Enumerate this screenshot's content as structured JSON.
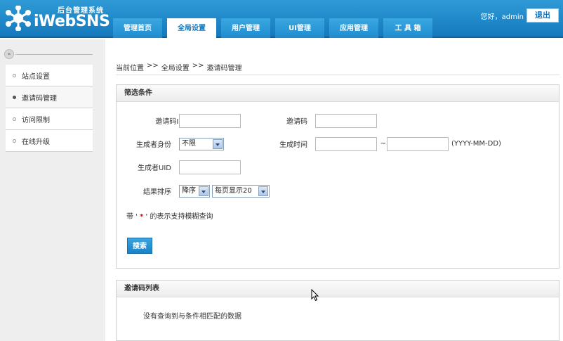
{
  "header": {
    "logo_small": "后台管理系统",
    "logo_big": "iWebSNS",
    "greeting": "您好，admin",
    "logout_label": "退出"
  },
  "nav": {
    "tabs": [
      {
        "label": "管理首页",
        "active": false
      },
      {
        "label": "全局设置",
        "active": true
      },
      {
        "label": "用户管理",
        "active": false
      },
      {
        "label": "UI管理",
        "active": false
      },
      {
        "label": "应用管理",
        "active": false
      },
      {
        "label": "工 具 箱",
        "active": false
      }
    ]
  },
  "sidebar": {
    "collapse_glyph": "«",
    "items": [
      {
        "label": "站点设置",
        "active": false
      },
      {
        "label": "邀请码管理",
        "active": true
      },
      {
        "label": "访问限制",
        "active": false
      },
      {
        "label": "在线升级",
        "active": false
      }
    ]
  },
  "breadcrumb": {
    "prefix": "当前位置",
    "sep": ">>",
    "level1": "全局设置",
    "level2": "邀请码管理"
  },
  "filter": {
    "title": "筛选条件",
    "invite_id_label": "邀请码ID",
    "invite_id_value": "",
    "invite_code_label": "邀请码",
    "invite_code_value": "",
    "creator_role_label": "生成者身份",
    "creator_role_value": "不限",
    "created_time_label": "生成时间",
    "time_from_value": "",
    "time_sep": "~",
    "time_to_value": "",
    "date_format": "(YYYY-MM-DD)",
    "creator_uid_label": "生成者UID",
    "creator_uid_value": "",
    "sort_label": "结果排序",
    "sort_order_value": "降序",
    "page_size_value": "每页显示20",
    "hint_pre": "带 ' ",
    "hint_star": "*",
    "hint_post": " ' 的表示支持模糊查询",
    "search_label": "搜索"
  },
  "list": {
    "title": "邀请码列表",
    "empty_message": "没有查询到与条件相匹配的数据"
  },
  "colors": {
    "header_blue": "#1479bd",
    "accent": "#1a82c6",
    "required_star": "#e00000"
  }
}
